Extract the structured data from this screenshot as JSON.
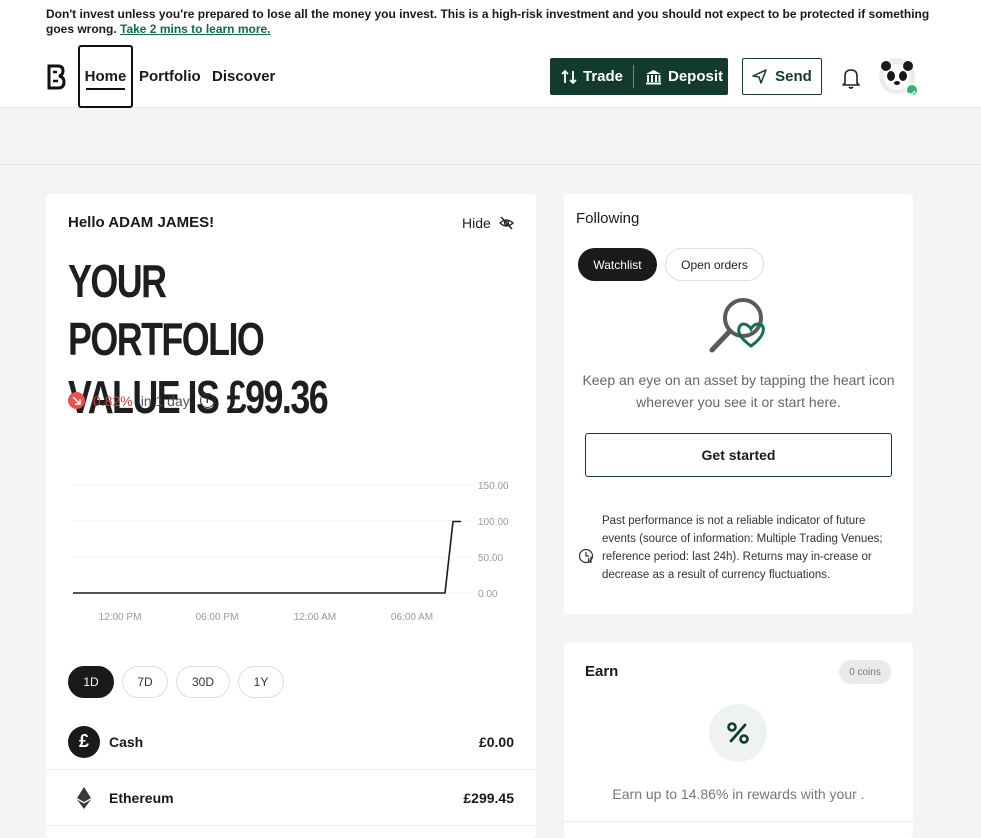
{
  "banner": {
    "text": "Don't invest unless you're prepared to lose all the money you invest. This is a high-risk investment and you should not expect to be protected if something goes wrong.",
    "link": "Take 2 mins to learn more."
  },
  "nav": {
    "home": "Home",
    "portfolio": "Portfolio",
    "discover": "Discover",
    "trade": "Trade",
    "deposit": "Deposit",
    "send": "Send"
  },
  "portfolio": {
    "greeting": "Hello ADAM JAMES!",
    "hide": "Hide",
    "title_line1": "YOUR PORTFOLIO",
    "title_line2": "VALUE IS £99.36",
    "change_pct": "0.82%",
    "change_period": "in 1 day"
  },
  "chart_data": {
    "type": "line",
    "x": [
      "12:00 PM",
      "06:00 PM",
      "12:00 AM",
      "06:00 AM"
    ],
    "y_ticks": [
      "150.00",
      "100.00",
      "50.00",
      "0.00"
    ],
    "ylim": [
      0,
      150
    ],
    "series": [
      {
        "points": [
          [
            0,
            0
          ],
          [
            0.93,
            0
          ],
          [
            0.95,
            99.36
          ],
          [
            0.97,
            99.36
          ]
        ]
      }
    ],
    "grid": "dotted horizontal",
    "line_color": "#1a1a1a"
  },
  "ranges": [
    "1D",
    "7D",
    "30D",
    "1Y"
  ],
  "active_range": "1D",
  "assets": [
    {
      "name": "Cash",
      "value": "£0.00"
    },
    {
      "name": "Ethereum",
      "value": "£299.45"
    }
  ],
  "following": {
    "title": "Following",
    "tab_watchlist": "Watchlist",
    "tab_open_orders": "Open orders",
    "empty_text": "Keep an eye on an asset by tapping the heart icon wherever you see it or start here.",
    "cta": "Get started",
    "disclaimer": "Past performance is not a reliable indicator of future events (source of information: Multiple Trading Venues; reference period: last 24h). Returns may in-crease or decrease as a result of currency fluctuations."
  },
  "earn": {
    "title": "Earn",
    "coins": "0 coins",
    "text": "Earn up to 14.86% in rewards with your ."
  },
  "colors": {
    "brand_dark": "#123b2d",
    "negative": "#d23c3a",
    "success": "#2fb56d"
  }
}
